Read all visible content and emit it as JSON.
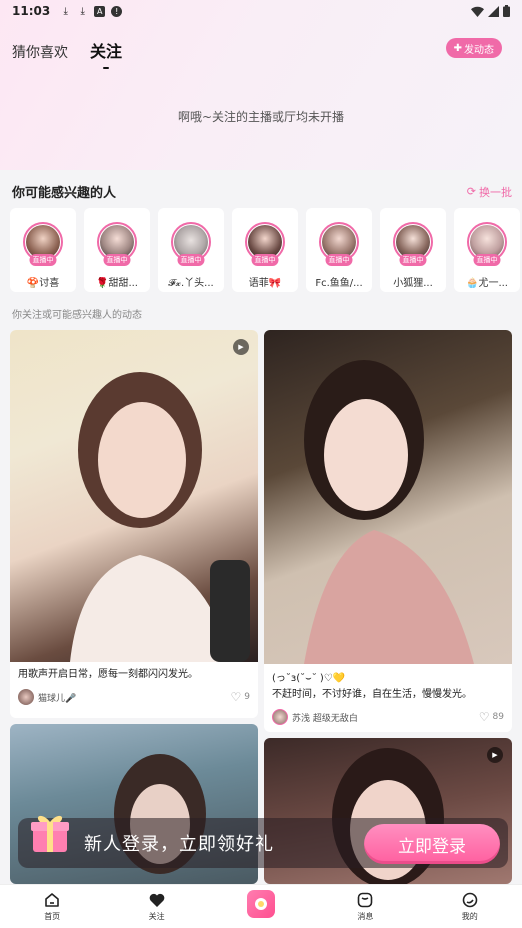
{
  "status_bar": {
    "time": "11:03"
  },
  "top_tabs": [
    {
      "label": "猜你喜欢"
    },
    {
      "label": "关注"
    }
  ],
  "post_button": {
    "label": "发动态"
  },
  "empty_message": "啊哦~关注的主播或厅均未开播",
  "recommend": {
    "title": "你可能感兴趣的人",
    "refresh_label": "换一批",
    "live_badge": "直播中",
    "users": [
      {
        "name": "🍄讨喜"
      },
      {
        "name": "🌹甜甜..."
      },
      {
        "name": "𝓕𝔁.丫头..."
      },
      {
        "name": "语菲🎀"
      },
      {
        "name": "Fc.鱼鱼/..."
      },
      {
        "name": "小狐狸..."
      },
      {
        "name": "🧁尤一..."
      }
    ]
  },
  "feed": {
    "title": "你关注或可能感兴趣人的动态",
    "posts": [
      {
        "caption": "用歌声开启日常，愿每一刻都闪闪发光。",
        "author": "猫球儿🎤",
        "likes": "9",
        "video": true
      },
      {
        "caption_line1": "(っ˘з(˘⌣˘ )♡💛",
        "caption_line2": "不赶时间，不讨好谁，自在生活，慢慢发光。",
        "author": "苏浅 超级无敌白",
        "likes": "89",
        "video": false
      },
      {
        "video": false
      },
      {
        "video": true
      }
    ]
  },
  "promo": {
    "text": "新人登录，立即领好礼",
    "button_label": "立即登录"
  },
  "bottom_nav": [
    {
      "label": "首页"
    },
    {
      "label": "关注"
    },
    {
      "label": ""
    },
    {
      "label": "消息"
    },
    {
      "label": "我的"
    }
  ],
  "colors": {
    "accent": "#f06aa8",
    "background": "#f4f4f6"
  }
}
